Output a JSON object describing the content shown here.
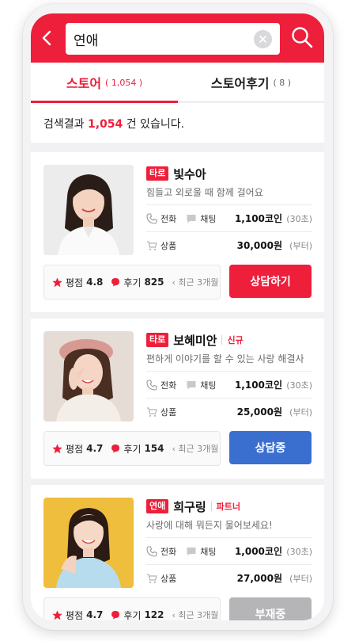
{
  "search": {
    "value": "연애"
  },
  "tabs": [
    {
      "label": "스토어",
      "count": "( 1,054 )"
    },
    {
      "label": "스토어후기",
      "count": "( 8 )"
    }
  ],
  "result": {
    "prefix": "검색결과 ",
    "count": "1,054",
    "suffix": " 건 있습니다."
  },
  "row_labels": {
    "phone": "전화",
    "chat": "채팅",
    "product": "상품"
  },
  "counselors": [
    {
      "category": "타로",
      "name": "빛수아",
      "tag": "",
      "intro": "힘들고 외로울 때 함께 걸어요",
      "call_price": "1,100코인",
      "call_unit": "(30초)",
      "product_price": "30,000원",
      "product_unit": "(부터)",
      "rating_label": "평점",
      "rating": "4.8",
      "review_label": "후기",
      "reviews": "825",
      "recent": "최근 3개월",
      "button": "상담하기",
      "button_color": "#ee1f3b"
    },
    {
      "category": "타로",
      "name": "보혜미안",
      "tag": "신규",
      "intro": "편하게 이야기를 할 수 있는 사랑 해결사",
      "call_price": "1,100코인",
      "call_unit": "(30초)",
      "product_price": "25,000원",
      "product_unit": "(부터)",
      "rating_label": "평점",
      "rating": "4.7",
      "review_label": "후기",
      "reviews": "154",
      "recent": "최근 3개월",
      "button": "상담중",
      "button_color": "#3a6fd0"
    },
    {
      "category": "연애",
      "name": "희구링",
      "tag": "파트너",
      "intro": "사랑에 대해 뭐든지 물어보세요!",
      "call_price": "1,000코인",
      "call_unit": "(30초)",
      "product_price": "27,000원",
      "product_unit": "(부터)",
      "rating_label": "평점",
      "rating": "4.7",
      "review_label": "후기",
      "reviews": "122",
      "recent": "최근 3개월",
      "button": "부재중",
      "button_color": "#b5b5b8"
    }
  ],
  "colors": {
    "accent": "#ee1f3b",
    "busy": "#3a6fd0",
    "absent": "#b5b5b8"
  }
}
